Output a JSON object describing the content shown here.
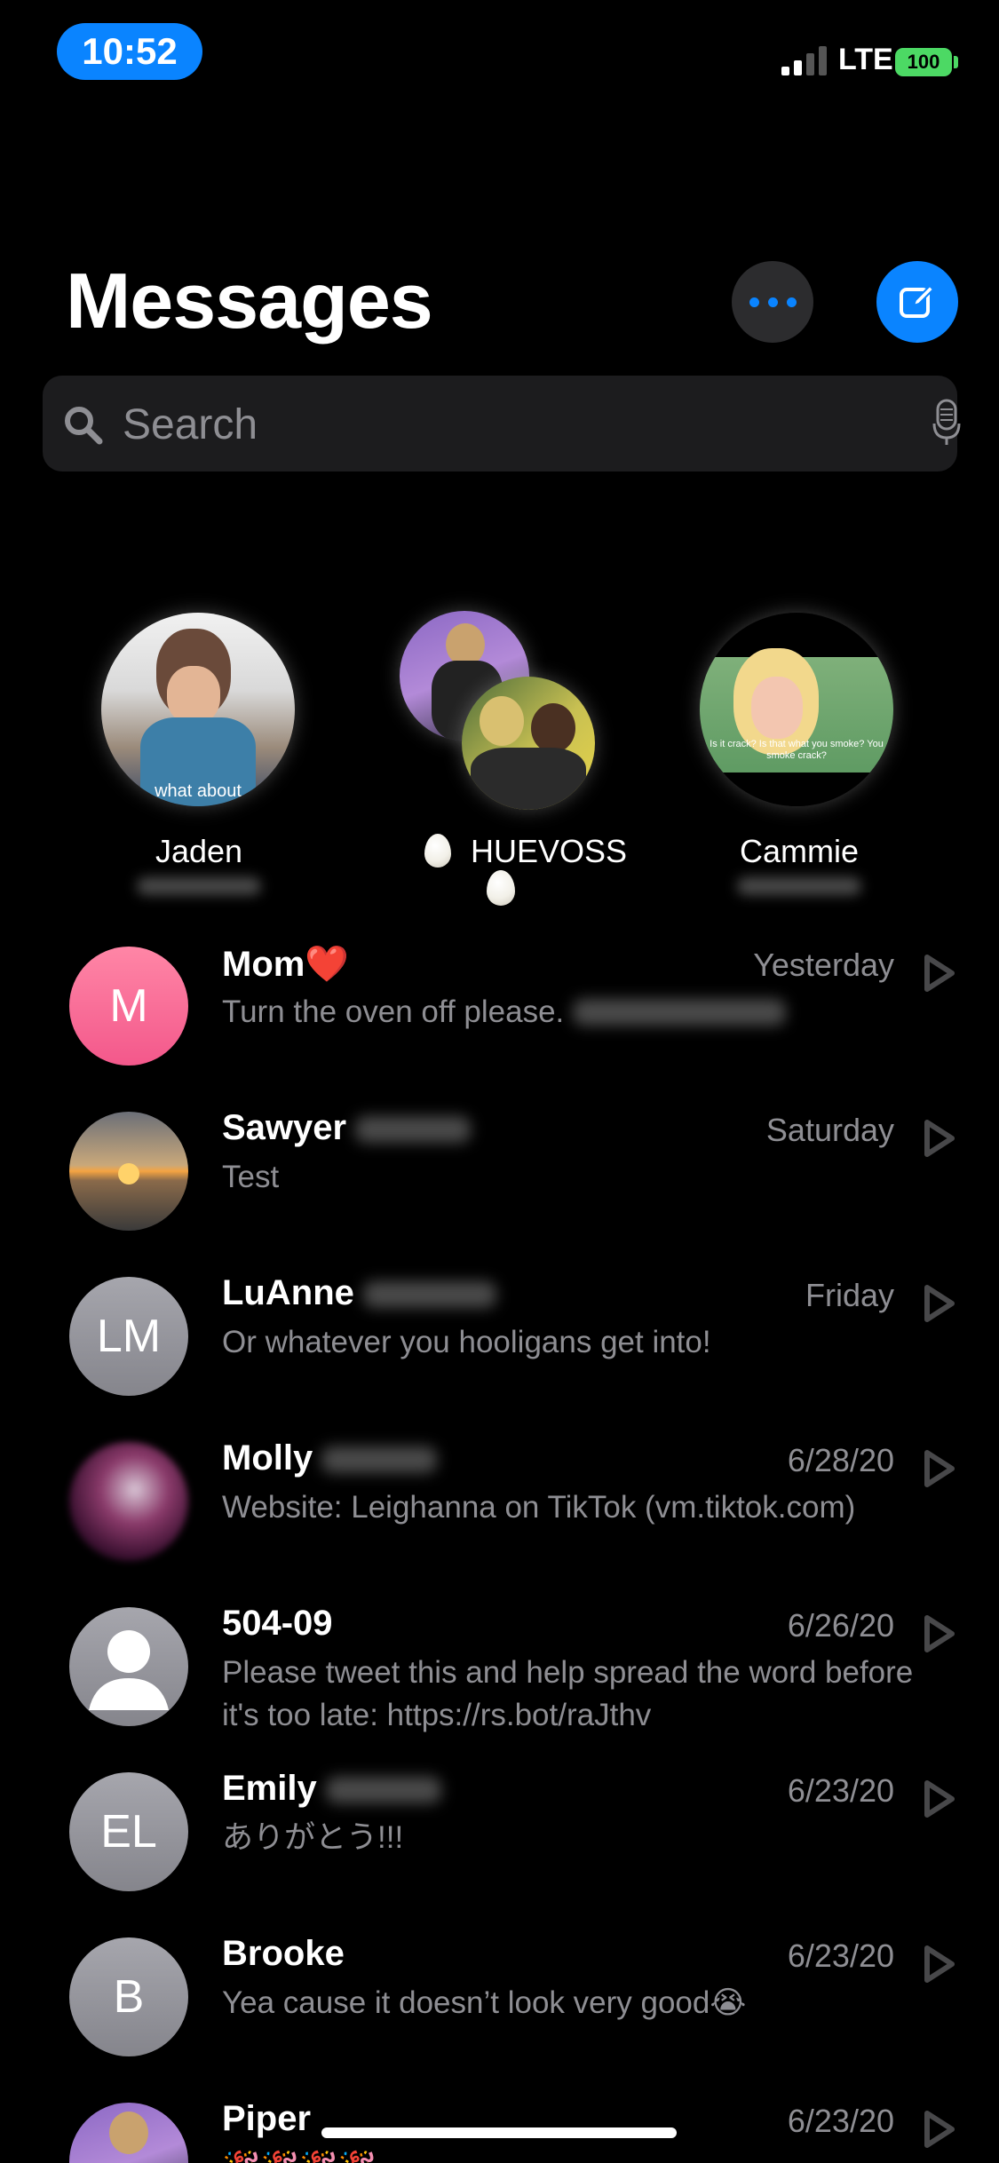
{
  "status_bar": {
    "time": "10:52",
    "network": "LTE",
    "battery": "100",
    "signal_bars": 2,
    "signal_max": 4
  },
  "header": {
    "title": "Messages",
    "more_icon": "ellipsis-icon",
    "compose_icon": "compose-icon"
  },
  "search": {
    "placeholder": "Search",
    "value": "",
    "search_icon": "magnifier-icon",
    "mic_icon": "microphone-icon"
  },
  "pinned": [
    {
      "name": "Jaden",
      "caption": "what about"
    },
    {
      "name": "HUEVOSS",
      "emoji": "egg"
    },
    {
      "name": "Cammie",
      "caption": "Is it crack? Is that what you smoke? You smoke crack?"
    }
  ],
  "conversations": [
    {
      "name": "Mom❤️",
      "initials": "M",
      "date": "Yesterday",
      "preview": "Turn the oven off please."
    },
    {
      "name": "Sawyer",
      "initials": "",
      "date": "Saturday",
      "preview": "Test"
    },
    {
      "name": "LuAnne",
      "initials": "LM",
      "date": "Friday",
      "preview": "Or whatever you hooligans get into!"
    },
    {
      "name": "Molly",
      "initials": "",
      "date": "6/28/20",
      "preview": "Website: Leighanna on TikTok (vm.tiktok.com)"
    },
    {
      "name": "504-09",
      "initials": "",
      "date": "6/26/20",
      "preview": "Please tweet this and help spread the word before it's too late: https://rs.bot/raJthv"
    },
    {
      "name": "Emily",
      "initials": "EL",
      "date": "6/23/20",
      "preview": "ありがとう!!!"
    },
    {
      "name": "Brooke",
      "initials": "B",
      "date": "6/23/20",
      "preview": "Yea cause it doesn’t look very good😭"
    },
    {
      "name": "Piper",
      "initials": "",
      "date": "6/23/20",
      "preview": "🎉🎉🎉🎉"
    }
  ],
  "colors": {
    "accent": "#0a84ff",
    "background": "#000000",
    "secondary_text": "#8e8e93",
    "battery": "#4cd964"
  }
}
